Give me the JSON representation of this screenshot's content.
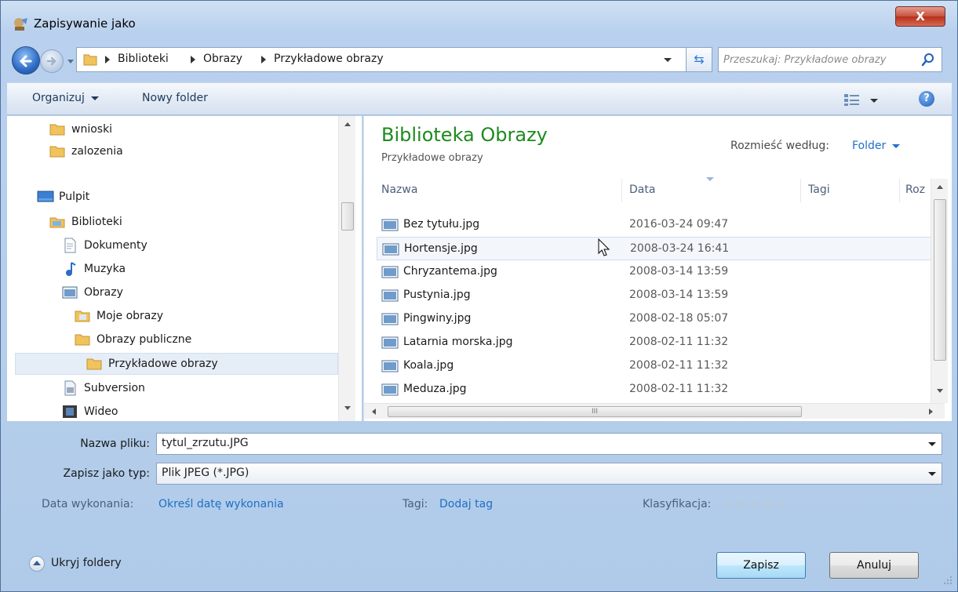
{
  "window": {
    "title": "Zapisywanie jako",
    "close_label": "X"
  },
  "address_bar": {
    "crumbs": [
      "Biblioteki",
      "Obrazy",
      "Przykładowe obrazy"
    ]
  },
  "search": {
    "placeholder": "Przeszukaj: Przykładowe obrazy"
  },
  "toolbar": {
    "organize_label": "Organizuj",
    "new_folder_label": "Nowy folder",
    "help_label": "?"
  },
  "nav_pane": {
    "items": [
      {
        "label": "wnioski",
        "icon": "folder-icon"
      },
      {
        "label": "zalozenia",
        "icon": "folder-icon"
      },
      {
        "label": "Pulpit",
        "icon": "desktop-icon"
      },
      {
        "label": "Biblioteki",
        "icon": "libraries-icon"
      },
      {
        "label": "Dokumenty",
        "icon": "documents-icon"
      },
      {
        "label": "Muzyka",
        "icon": "music-icon"
      },
      {
        "label": "Obrazy",
        "icon": "pictures-icon"
      },
      {
        "label": "Moje obrazy",
        "icon": "folder-icon"
      },
      {
        "label": "Obrazy publiczne",
        "icon": "folder-icon"
      },
      {
        "label": "Przykładowe obrazy",
        "icon": "folder-icon",
        "selected": true
      },
      {
        "label": "Subversion",
        "icon": "subversion-icon"
      },
      {
        "label": "Wideo",
        "icon": "video-icon"
      }
    ]
  },
  "library": {
    "title": "Biblioteka Obrazy",
    "subtitle": "Przykładowe obrazy",
    "arrange_label": "Rozmieść według:",
    "arrange_value": "Folder"
  },
  "file_list": {
    "columns": [
      "Nazwa",
      "Data",
      "Tagi",
      "Roz"
    ],
    "rows": [
      {
        "name": "Bez tytułu.jpg",
        "date": "2016-03-24 09:47"
      },
      {
        "name": "Hortensje.jpg",
        "date": "2008-03-24 16:41",
        "hover": true
      },
      {
        "name": "Chryzantema.jpg",
        "date": "2008-03-14 13:59"
      },
      {
        "name": "Pustynia.jpg",
        "date": "2008-03-14 13:59"
      },
      {
        "name": "Pingwiny.jpg",
        "date": "2008-02-18 05:07"
      },
      {
        "name": "Latarnia morska.jpg",
        "date": "2008-02-11 11:32"
      },
      {
        "name": "Koala.jpg",
        "date": "2008-02-11 11:32"
      },
      {
        "name": "Meduza.jpg",
        "date": "2008-02-11 11:32"
      }
    ],
    "hscroll_grip": "III"
  },
  "form": {
    "filename_label": "Nazwa pliku:",
    "filename_value": "tytul_zrzutu.JPG",
    "type_label": "Zapisz jako typ:",
    "type_value": "Plik JPEG (*.JPG)",
    "date_label": "Data wykonania:",
    "date_link": "Określ datę wykonania",
    "tags_label": "Tagi:",
    "tags_link": "Dodaj tag",
    "rating_label": "Klasyfikacja:",
    "rating_stars": "☆☆☆☆☆"
  },
  "footer": {
    "hide_folders_label": "Ukryj foldery",
    "save_label": "Zapisz",
    "cancel_label": "Anuluj"
  },
  "colors": {
    "accent_green": "#1e8a1e",
    "link_blue": "#1f6fc5",
    "frame_blue": "#b9d1ee"
  }
}
